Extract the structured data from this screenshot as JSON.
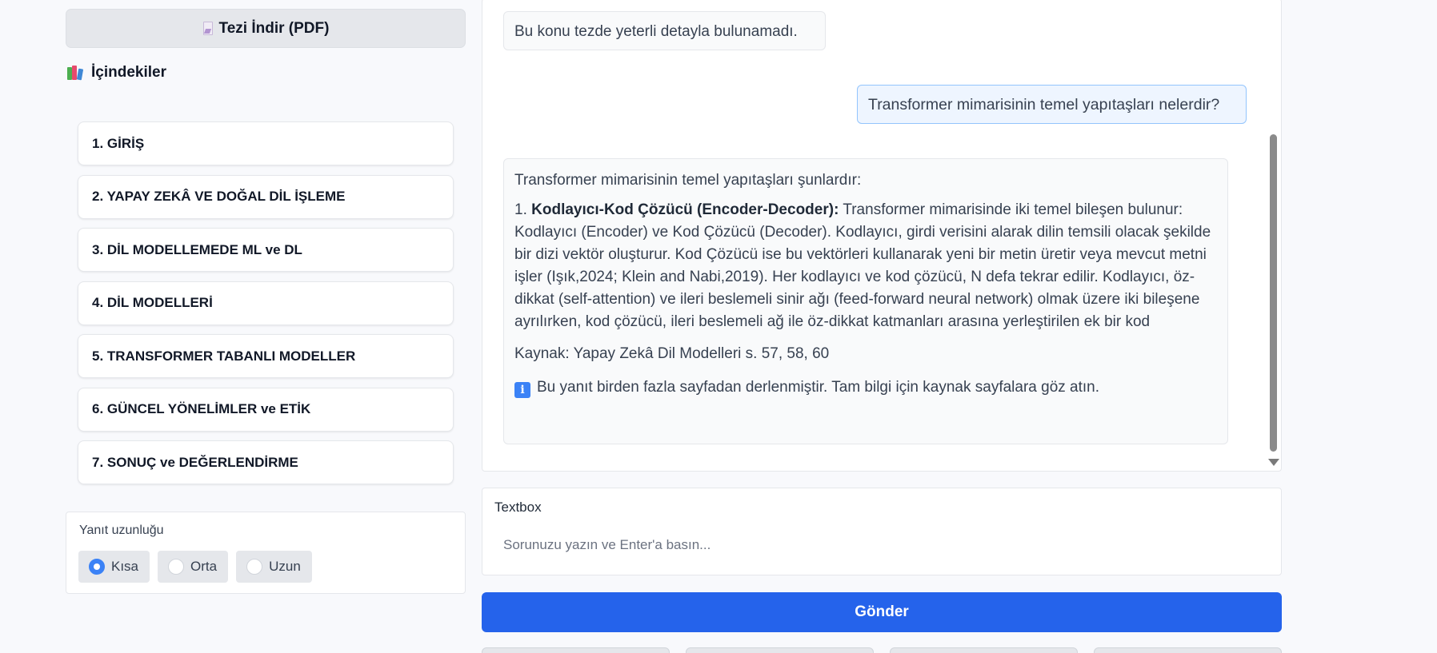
{
  "sidebar": {
    "download_label": "Tezi İndir (PDF)",
    "download_icon": "document-icon",
    "toc_title": "İçindekiler",
    "toc_icon": "books-icon",
    "toc_items": [
      {
        "label": "1. GİRİŞ"
      },
      {
        "label": "2. YAPAY ZEKÂ VE DOĞAL DİL İŞLEME"
      },
      {
        "label": "3. DİL MODELLEMEDE ML ve DL"
      },
      {
        "label": "4. DİL MODELLERİ"
      },
      {
        "label": "5. TRANSFORMER TABANLI MODELLER"
      },
      {
        "label": "6. GÜNCEL YÖNELİMLER ve ETİK"
      },
      {
        "label": "7. SONUÇ ve DEĞERLENDİRME"
      }
    ],
    "response_length": {
      "label": "Yanıt uzunluğu",
      "options": [
        "Kısa",
        "Orta",
        "Uzun"
      ],
      "selected": "Kısa"
    }
  },
  "chat": {
    "bot_message_1": "Bu konu tezde yeterli detayla bulunamadı.",
    "user_message": "Transformer mimarisinin temel yapıtaşları nelerdir?",
    "bot_message_2": {
      "intro": "Transformer mimarisinin temel yapıtaşları şunlardır:",
      "item_number": "1.",
      "item_title": "Kodlayıcı-Kod Çözücü (Encoder-Decoder):",
      "item_text": "Transformer mimarisinde iki temel bileşen bulunur: Kodlayıcı (Encoder) ve Kod Çözücü (Decoder). Kodlayıcı, girdi verisini alarak dilin temsili olacak şekilde bir dizi vektör oluşturur. Kod Çözücü ise bu vektörleri kullanarak yeni bir metin üretir veya mevcut metni işler (Işık,2024; Klein and Nabi,2019). Her kodlayıcı ve kod çözücü, N defa tekrar edilir. Kodlayıcı, öz-dikkat (self-attention) ve ileri beslemeli sinir ağı (feed-forward neural network) olmak üzere iki bileşene ayrılırken, kod çözücü, ileri beslemeli ağ ile öz-dikkat katmanları arasına yerleştirilen ek bir kod",
      "source": "Kaynak: Yapay Zekâ Dil Modelleri s. 57, 58, 60",
      "info_icon": "info-icon",
      "info_glyph": "i",
      "note": "Bu yanıt birden fazla sayfadan derlenmiştir. Tam bilgi için kaynak sayfalara göz atın."
    }
  },
  "input": {
    "label": "Textbox",
    "placeholder": "Sorunuzu yazın ve Enter'a basın...",
    "value": ""
  },
  "send_label": "Gönder",
  "colors": {
    "accent": "#2563eb",
    "radio_selected": "#3b82f6",
    "user_bubble_bg": "#eef5ff",
    "user_bubble_border": "#93c5fd"
  }
}
